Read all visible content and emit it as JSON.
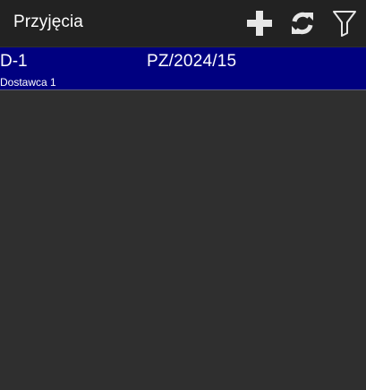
{
  "app_bar": {
    "title": "Przyjęcia",
    "icons": [
      "plus-icon",
      "refresh-icon",
      "filter-icon"
    ],
    "background": "#222222"
  },
  "list": {
    "selected_background": "#000080",
    "items": [
      {
        "code": "D-1",
        "document": "PZ/2024/15",
        "supplier": "Dostawca 1"
      }
    ]
  },
  "colors": {
    "page_background": "#2f2f2f",
    "icon_color": "#e6e6e6"
  }
}
